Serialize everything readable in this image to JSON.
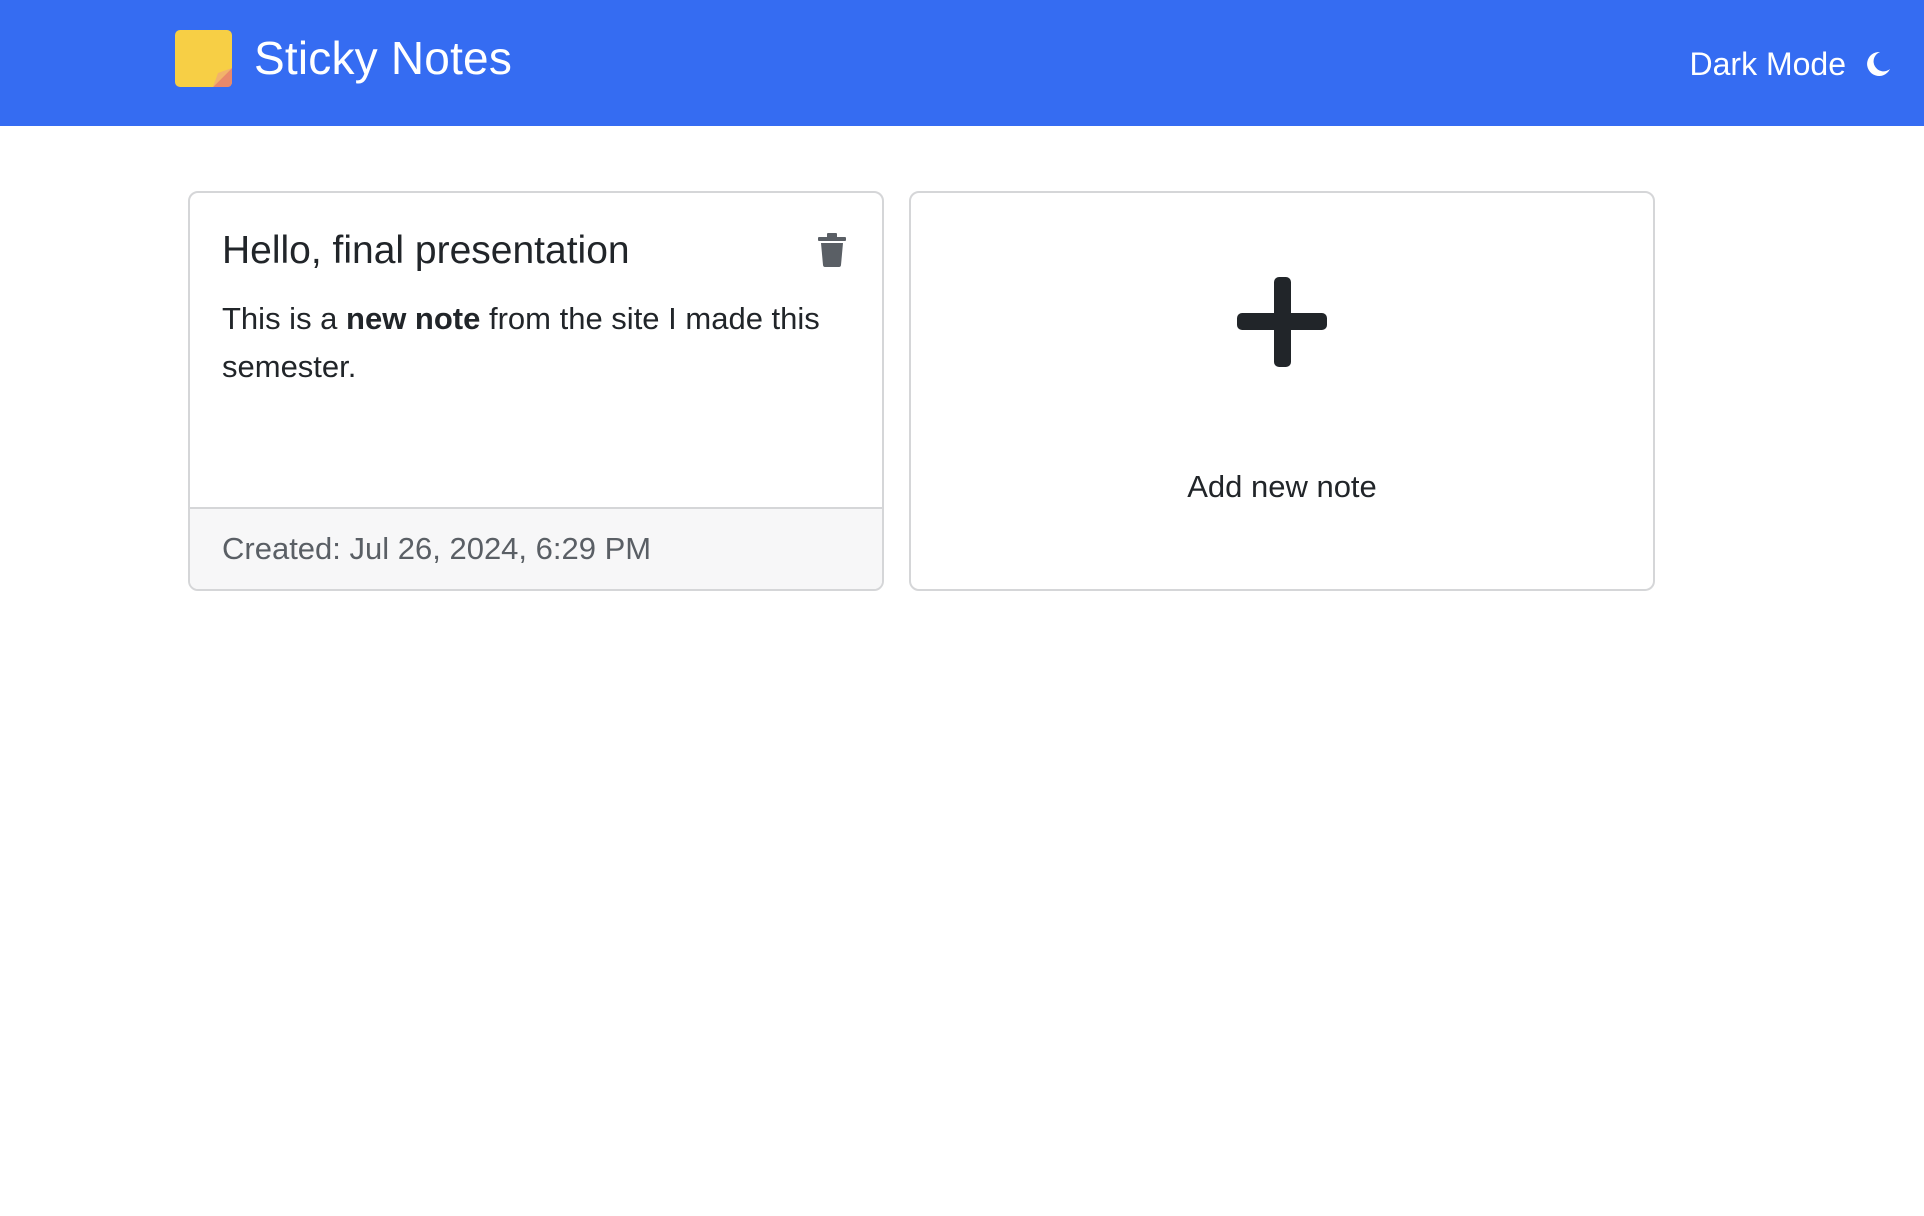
{
  "header": {
    "title": "Sticky Notes",
    "logo_icon": "sticky-note-icon",
    "dark_mode_label": "Dark Mode",
    "dark_mode_icon": "moon-icon",
    "background_color": "#356cf2"
  },
  "notes": [
    {
      "title": "Hello, final presentation",
      "body_prefix": "This is a ",
      "body_bold": "new note",
      "body_suffix": " from the site I made this semester.",
      "created": "Created: Jul 26, 2024, 6:29 PM",
      "delete_icon": "trash-icon"
    }
  ],
  "add_note": {
    "label": "Add new note",
    "icon": "plus-icon"
  }
}
